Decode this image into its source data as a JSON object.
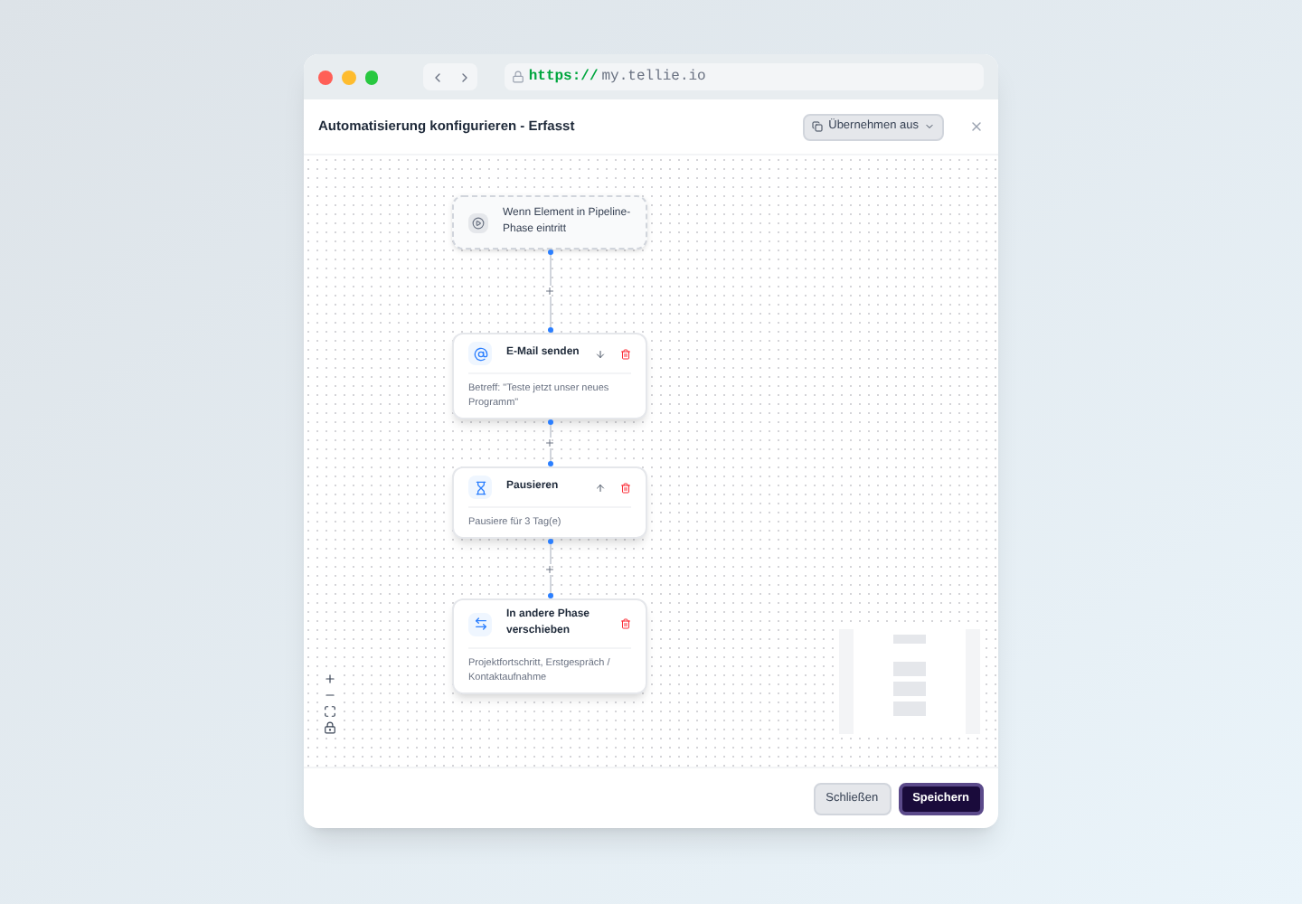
{
  "browser": {
    "url_scheme": "https://",
    "url_host": "my.tellie.io"
  },
  "dialog": {
    "title": "Automatisierung konfigurieren - Erfasst",
    "apply_from": "Übernehmen aus"
  },
  "nodes": [
    {
      "kind": "trigger",
      "title": "Wenn Element in Pipeline-Phase eintritt"
    },
    {
      "kind": "email",
      "title": "E-Mail senden",
      "detail": "Betreff: \"Teste jetzt unser neues Programm\"",
      "move_up": false,
      "move_down": true
    },
    {
      "kind": "pause",
      "title": "Pausieren",
      "detail": "Pausiere für 3 Tag(e)",
      "move_up": true,
      "move_down": false
    },
    {
      "kind": "move",
      "title": "In andere Phase verschieben",
      "detail": "Projektfortschritt, Erstgespräch / Kontaktaufnahme",
      "move_up": false,
      "move_down": false
    }
  ],
  "footer": {
    "close": "Schließen",
    "save": "Speichern"
  }
}
